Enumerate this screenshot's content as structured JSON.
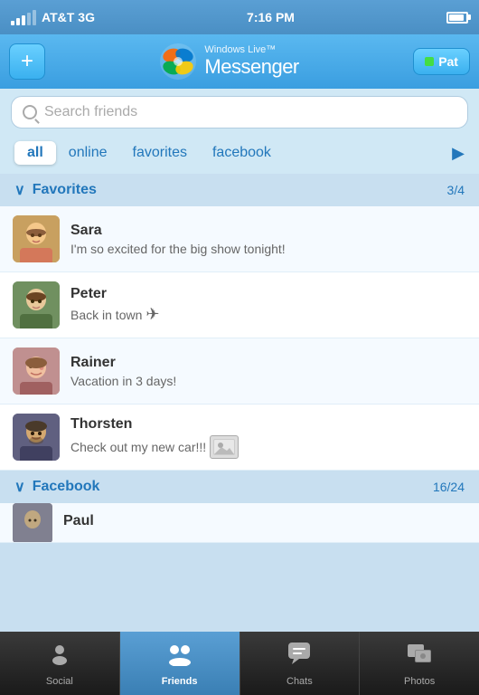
{
  "statusBar": {
    "carrier": "AT&T",
    "network": "3G",
    "time": "7:16 PM",
    "batteryFull": true
  },
  "header": {
    "addButton": "+",
    "appName": "Messenger",
    "appNamePrefix": "Windows Live™",
    "profileName": "Pat"
  },
  "search": {
    "placeholder": "Search friends"
  },
  "filterTabs": {
    "tabs": [
      {
        "id": "all",
        "label": "all",
        "active": true
      },
      {
        "id": "online",
        "label": "online",
        "active": false
      },
      {
        "id": "favorites",
        "label": "favorites",
        "active": false
      },
      {
        "id": "facebook",
        "label": "facebook",
        "active": false
      }
    ],
    "moreArrow": "▶"
  },
  "sections": [
    {
      "id": "favorites",
      "title": "Favorites",
      "count": "3/4",
      "contacts": [
        {
          "id": "sara",
          "name": "Sara",
          "status": "I'm so excited for the big show tonight!",
          "hasImageBadge": false,
          "hasPlane": false,
          "emoji": "👩"
        },
        {
          "id": "peter",
          "name": "Peter",
          "status": "Back in town",
          "hasPlane": true,
          "hasImageBadge": false,
          "emoji": "👨"
        },
        {
          "id": "rainer",
          "name": "Rainer",
          "status": "Vacation in 3 days!",
          "hasImageBadge": false,
          "hasPlane": false,
          "emoji": "👫"
        },
        {
          "id": "thorsten",
          "name": "Thorsten",
          "status": "Check out my new car!!!",
          "hasImageBadge": true,
          "hasPlane": false,
          "emoji": "🧔"
        }
      ]
    },
    {
      "id": "facebook",
      "title": "Facebook",
      "count": "16/24",
      "contacts": [
        {
          "id": "paul",
          "name": "Paul",
          "status": "",
          "hasImageBadge": false,
          "hasPlane": false,
          "emoji": "👤"
        }
      ]
    }
  ],
  "bottomNav": {
    "items": [
      {
        "id": "social",
        "label": "Social",
        "icon": "👤",
        "active": false
      },
      {
        "id": "friends",
        "label": "Friends",
        "icon": "👥",
        "active": true
      },
      {
        "id": "chats",
        "label": "Chats",
        "icon": "💬",
        "active": false
      },
      {
        "id": "photos",
        "label": "Photos",
        "icon": "🖼",
        "active": false
      }
    ]
  }
}
